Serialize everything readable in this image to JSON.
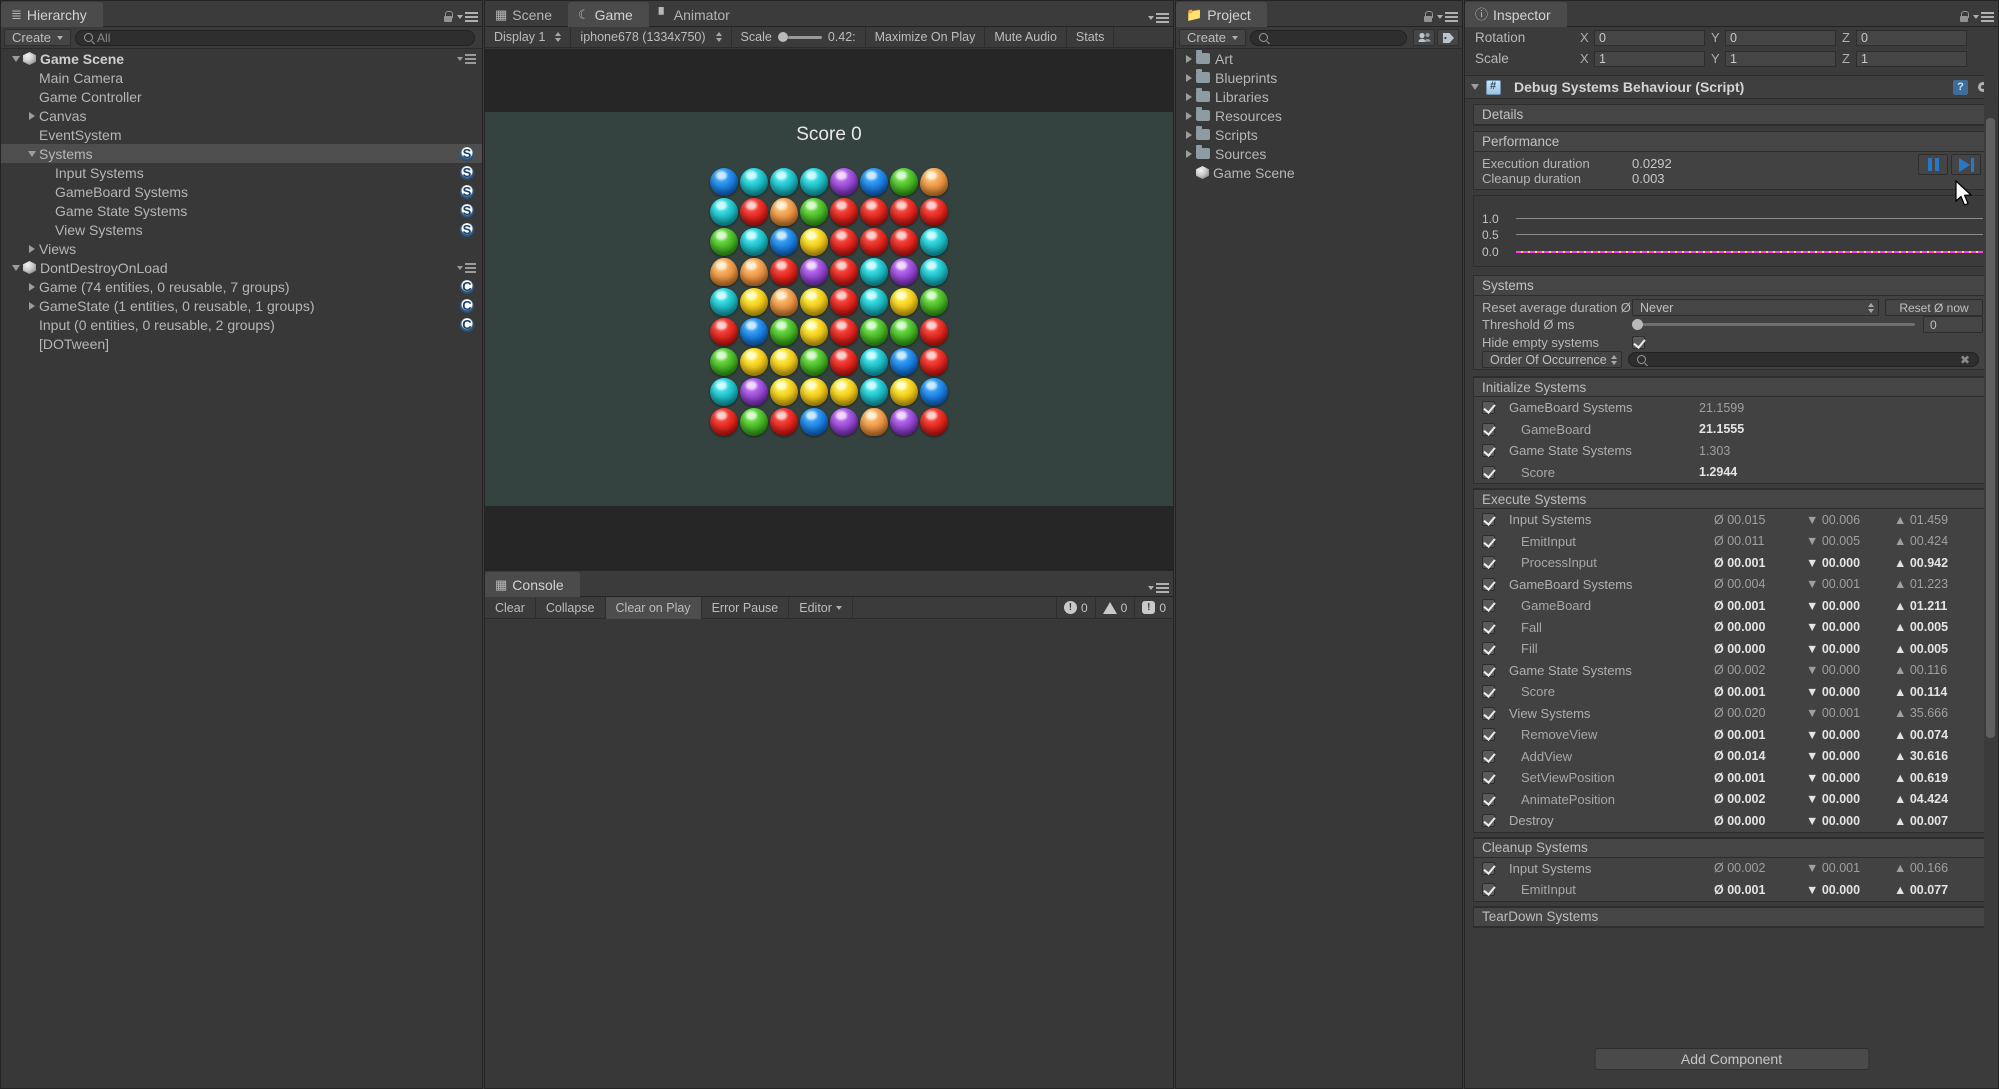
{
  "hierarchy": {
    "tab_label": "Hierarchy",
    "tab_icon": "hierarchy-icon",
    "create_label": "Create",
    "search_value": "All",
    "search_icon": "search-icon",
    "items": [
      {
        "label": "Game Scene",
        "depth": 0,
        "twisty": "down",
        "icon": "unity-scene-icon",
        "bold": true,
        "badge": "",
        "menu": true,
        "selected": false
      },
      {
        "label": "Main Camera",
        "depth": 1,
        "twisty": "",
        "icon": "",
        "bold": false,
        "badge": "",
        "menu": false,
        "selected": false
      },
      {
        "label": "Game Controller",
        "depth": 1,
        "twisty": "",
        "icon": "",
        "bold": false,
        "badge": "",
        "menu": false,
        "selected": false
      },
      {
        "label": "Canvas",
        "depth": 1,
        "twisty": "right",
        "icon": "",
        "bold": false,
        "badge": "",
        "menu": false,
        "selected": false
      },
      {
        "label": "EventSystem",
        "depth": 1,
        "twisty": "",
        "icon": "",
        "bold": false,
        "badge": "",
        "menu": false,
        "selected": false
      },
      {
        "label": "Systems",
        "depth": 1,
        "twisty": "down",
        "icon": "",
        "bold": false,
        "badge": "S",
        "menu": false,
        "selected": true
      },
      {
        "label": "Input Systems",
        "depth": 2,
        "twisty": "",
        "icon": "",
        "bold": false,
        "badge": "S",
        "menu": false,
        "selected": false
      },
      {
        "label": "GameBoard Systems",
        "depth": 2,
        "twisty": "",
        "icon": "",
        "bold": false,
        "badge": "S",
        "menu": false,
        "selected": false
      },
      {
        "label": "Game State Systems",
        "depth": 2,
        "twisty": "",
        "icon": "",
        "bold": false,
        "badge": "S",
        "menu": false,
        "selected": false
      },
      {
        "label": "View Systems",
        "depth": 2,
        "twisty": "",
        "icon": "",
        "bold": false,
        "badge": "S",
        "menu": false,
        "selected": false
      },
      {
        "label": "Views",
        "depth": 1,
        "twisty": "right",
        "icon": "",
        "bold": false,
        "badge": "",
        "menu": false,
        "selected": false
      },
      {
        "label": "DontDestroyOnLoad",
        "depth": 0,
        "twisty": "down",
        "icon": "unity-scene-icon",
        "bold": false,
        "badge": "",
        "menu": true,
        "selected": false
      },
      {
        "label": "Game (74 entities, 0 reusable, 7 groups)",
        "depth": 1,
        "twisty": "right",
        "icon": "",
        "bold": false,
        "badge": "C",
        "menu": false,
        "selected": false
      },
      {
        "label": "GameState (1 entities, 0 reusable, 1 groups)",
        "depth": 1,
        "twisty": "right",
        "icon": "",
        "bold": false,
        "badge": "C",
        "menu": false,
        "selected": false
      },
      {
        "label": "Input (0 entities, 0 reusable, 2 groups)",
        "depth": 1,
        "twisty": "",
        "icon": "",
        "bold": false,
        "badge": "C",
        "menu": false,
        "selected": false
      },
      {
        "label": "[DOTween]",
        "depth": 1,
        "twisty": "",
        "icon": "",
        "bold": false,
        "badge": "",
        "menu": false,
        "selected": false
      }
    ]
  },
  "gameview": {
    "tabs": [
      {
        "label": "Scene",
        "icon": "grid-icon",
        "active": false
      },
      {
        "label": "Game",
        "icon": "gamepad-icon",
        "active": true
      },
      {
        "label": "Animator",
        "icon": "animator-icon",
        "active": false
      }
    ],
    "display": "Display 1",
    "resolution": "iphone678 (1334x750)",
    "scale_label": "Scale",
    "scale_value": "0.42:",
    "maximize_label": "Maximize On Play",
    "mute_label": "Mute Audio",
    "stats_label": "Stats",
    "score_text": "Score 0",
    "board_background": "#344240",
    "gem_palette": {
      "blue": "#1f86e8",
      "cyan": "#22c3cc",
      "green": "#4fbe2b",
      "red": "#e82b22",
      "yellow": "#f7cf1f",
      "purple": "#9b4dd8",
      "orange": "#f09a4a"
    },
    "board": [
      [
        "blue",
        "cyan",
        "cyan",
        "cyan",
        "purple",
        "blue",
        "green",
        "orange-blob"
      ],
      [
        "cyan",
        "red",
        "orange-blob",
        "green",
        "red",
        "red",
        "red",
        "red"
      ],
      [
        "green",
        "cyan",
        "blue",
        "yellow",
        "red",
        "red",
        "red",
        "cyan"
      ],
      [
        "orange-blob",
        "orange-blob",
        "red",
        "purple",
        "red",
        "cyan",
        "purple",
        "cyan"
      ],
      [
        "cyan",
        "yellow",
        "orange-blob",
        "yellow",
        "red",
        "cyan",
        "yellow",
        "green"
      ],
      [
        "red",
        "blue",
        "green",
        "yellow",
        "red",
        "green",
        "green",
        "red"
      ],
      [
        "green",
        "yellow",
        "yellow",
        "green",
        "red",
        "cyan",
        "blue",
        "red"
      ],
      [
        "cyan",
        "purple",
        "yellow",
        "yellow",
        "yellow",
        "cyan",
        "yellow",
        "blue"
      ],
      [
        "red",
        "green",
        "red",
        "blue",
        "purple",
        "orange-blob",
        "purple",
        "red"
      ]
    ]
  },
  "console": {
    "tab_label": "Console",
    "tab_icon": "console-icon",
    "clear_label": "Clear",
    "collapse_label": "Collapse",
    "clear_on_play_label": "Clear on Play",
    "error_pause_label": "Error Pause",
    "editor_label": "Editor",
    "counts": [
      {
        "icon": "error-icon",
        "value": "0"
      },
      {
        "icon": "warning-icon",
        "value": "0"
      },
      {
        "icon": "info-icon",
        "value": "0"
      }
    ]
  },
  "project": {
    "tab_label": "Project",
    "tab_icon": "folder-icon",
    "create_label": "Create",
    "search_placeholder": "",
    "icon_buttons": [
      "favorites-icon",
      "label-icon"
    ],
    "items": [
      {
        "label": "Art",
        "type": "folder",
        "twisty": "right"
      },
      {
        "label": "Blueprints",
        "type": "folder",
        "twisty": "right"
      },
      {
        "label": "Libraries",
        "type": "folder",
        "twisty": "right"
      },
      {
        "label": "Resources",
        "type": "folder",
        "twisty": "right"
      },
      {
        "label": "Scripts",
        "type": "folder",
        "twisty": "right"
      },
      {
        "label": "Sources",
        "type": "folder",
        "twisty": "right"
      },
      {
        "label": "Game Scene",
        "type": "scene",
        "twisty": ""
      }
    ]
  },
  "inspector": {
    "tab_label": "Inspector",
    "tab_icon": "info-icon",
    "transform": [
      {
        "label": "Rotation",
        "x": "0",
        "y": "0",
        "z": "0"
      },
      {
        "label": "Scale",
        "x": "1",
        "y": "1",
        "z": "1"
      }
    ],
    "component_title": "Debug Systems Behaviour (Script)",
    "details_label": "Details",
    "performance_label": "Performance",
    "execution_duration_label": "Execution duration",
    "execution_duration_value": "0.0292",
    "cleanup_duration_label": "Cleanup duration",
    "cleanup_duration_value": "0.003",
    "pause_button": "pause-icon",
    "step_button": "step-icon",
    "graph": {
      "ticks": [
        "1.0",
        "0.5",
        "0.0"
      ],
      "series_color": "#ff3df0"
    },
    "systems_label": "Systems",
    "reset_avg_label": "Reset average duration Ø",
    "reset_avg_value": "Never",
    "reset_now_label": "Reset Ø now",
    "threshold_label": "Threshold Ø ms",
    "threshold_value": "0",
    "hide_empty_label": "Hide empty systems",
    "hide_empty_checked": true,
    "sort_value": "Order Of Occurrence",
    "sort_search_placeholder": "",
    "groups": [
      {
        "title": "Initialize Systems",
        "columns": 1,
        "rows": [
          {
            "name": "GameBoard Systems",
            "child": false,
            "checked": true,
            "avg": "21.1599",
            "hl": false
          },
          {
            "name": "GameBoard",
            "child": true,
            "checked": true,
            "avg": "21.1555",
            "hl": true
          },
          {
            "name": "Game State Systems",
            "child": false,
            "checked": true,
            "avg": "1.303",
            "hl": false
          },
          {
            "name": "Score",
            "child": true,
            "checked": true,
            "avg": "1.2944",
            "hl": true
          }
        ]
      },
      {
        "title": "Execute Systems",
        "columns": 3,
        "rows": [
          {
            "name": "Input Systems",
            "child": false,
            "checked": true,
            "avg": "Ø 00.015",
            "min": "▼ 00.006",
            "max": "▲ 01.459",
            "hl": false
          },
          {
            "name": "EmitInput",
            "child": true,
            "checked": true,
            "avg": "Ø 00.011",
            "min": "▼ 00.005",
            "max": "▲ 00.424",
            "hl": false
          },
          {
            "name": "ProcessInput",
            "child": true,
            "checked": true,
            "avg": "Ø 00.001",
            "min": "▼ 00.000",
            "max": "▲ 00.942",
            "hl": true
          },
          {
            "name": "GameBoard Systems",
            "child": false,
            "checked": true,
            "avg": "Ø 00.004",
            "min": "▼ 00.001",
            "max": "▲ 01.223",
            "hl": false
          },
          {
            "name": "GameBoard",
            "child": true,
            "checked": true,
            "avg": "Ø 00.001",
            "min": "▼ 00.000",
            "max": "▲ 01.211",
            "hl": true
          },
          {
            "name": "Fall",
            "child": true,
            "checked": true,
            "avg": "Ø 00.000",
            "min": "▼ 00.000",
            "max": "▲ 00.005",
            "hl": true
          },
          {
            "name": "Fill",
            "child": true,
            "checked": true,
            "avg": "Ø 00.000",
            "min": "▼ 00.000",
            "max": "▲ 00.005",
            "hl": true
          },
          {
            "name": "Game State Systems",
            "child": false,
            "checked": true,
            "avg": "Ø 00.002",
            "min": "▼ 00.000",
            "max": "▲ 00.116",
            "hl": false
          },
          {
            "name": "Score",
            "child": true,
            "checked": true,
            "avg": "Ø 00.001",
            "min": "▼ 00.000",
            "max": "▲ 00.114",
            "hl": true
          },
          {
            "name": "View Systems",
            "child": false,
            "checked": true,
            "avg": "Ø 00.020",
            "min": "▼ 00.001",
            "max": "▲ 35.666",
            "hl": false
          },
          {
            "name": "RemoveView",
            "child": true,
            "checked": true,
            "avg": "Ø 00.001",
            "min": "▼ 00.000",
            "max": "▲ 00.074",
            "hl": true
          },
          {
            "name": "AddView",
            "child": true,
            "checked": true,
            "avg": "Ø 00.014",
            "min": "▼ 00.000",
            "max": "▲ 30.616",
            "hl": true
          },
          {
            "name": "SetViewPosition",
            "child": true,
            "checked": true,
            "avg": "Ø 00.001",
            "min": "▼ 00.000",
            "max": "▲ 00.619",
            "hl": true
          },
          {
            "name": "AnimatePosition",
            "child": true,
            "checked": true,
            "avg": "Ø 00.002",
            "min": "▼ 00.000",
            "max": "▲ 04.424",
            "hl": true
          },
          {
            "name": "Destroy",
            "child": false,
            "checked": true,
            "avg": "Ø 00.000",
            "min": "▼ 00.000",
            "max": "▲ 00.007",
            "hl": true
          }
        ]
      },
      {
        "title": "Cleanup Systems",
        "columns": 3,
        "rows": [
          {
            "name": "Input Systems",
            "child": false,
            "checked": true,
            "avg": "Ø 00.002",
            "min": "▼ 00.001",
            "max": "▲ 00.166",
            "hl": false
          },
          {
            "name": "EmitInput",
            "child": true,
            "checked": true,
            "avg": "Ø 00.001",
            "min": "▼ 00.000",
            "max": "▲ 00.077",
            "hl": true
          }
        ]
      },
      {
        "title": "TearDown Systems",
        "columns": 3,
        "rows": []
      }
    ],
    "add_component_label": "Add Component"
  }
}
